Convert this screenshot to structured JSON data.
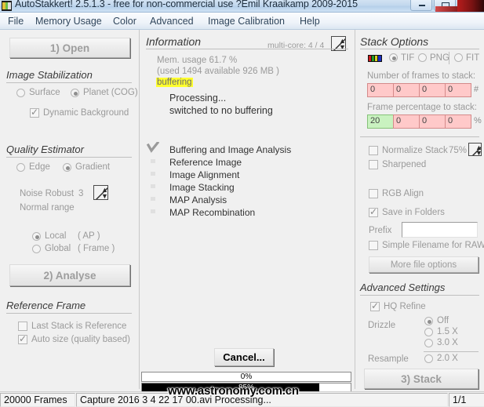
{
  "window": {
    "title": "AutoStakkert! 2.5.1.3 - free for non-commercial use ?Emil Kraaikamp 2009-2015",
    "icon": "app-icon",
    "minimize_label": "",
    "maximize_label": ""
  },
  "menubar": {
    "items": [
      {
        "label": "File"
      },
      {
        "label": "Memory Usage"
      },
      {
        "label": "Color"
      },
      {
        "label": "Advanced"
      },
      {
        "label": "Image Calibration"
      },
      {
        "label": "Help"
      }
    ]
  },
  "left_panel": {
    "open_button": "1) Open",
    "image_stabilization": {
      "title": "Image Stabilization",
      "surface_label": "Surface",
      "surface_selected": false,
      "planet_label": "Planet (COG)",
      "planet_selected": true,
      "dynamic_background_label": "Dynamic Background",
      "dynamic_background_checked": true
    },
    "quality_estimator": {
      "title": "Quality Estimator",
      "edge_label": "Edge",
      "edge_selected": false,
      "gradient_label": "Gradient",
      "gradient_selected": true,
      "noise_robust_label": "Noise Robust",
      "noise_robust_value": "3",
      "normal_range_label": "Normal range",
      "local_label": "Local",
      "local_sub": "( AP )",
      "local_selected": true,
      "global_label": "Global",
      "global_sub": "( Frame )",
      "global_selected": false
    },
    "analyse_button": "2) Analyse",
    "reference_frame": {
      "title": "Reference Frame",
      "last_stack_label": "Last Stack is Reference",
      "last_stack_checked": false,
      "auto_size_label": "Auto size (quality based)",
      "auto_size_checked": true
    }
  },
  "information": {
    "title": "Information",
    "multicore_label": "multi-core: 4 / 4",
    "mem_usage": "Mem. usage 61.7 %",
    "mem_detail": "(used 1494 available 926 MB )",
    "buffering_tag": "buffering",
    "processing_line": "Processing...",
    "switched_line": "switched to no buffering",
    "steps": [
      {
        "label": "Buffering and Image Analysis",
        "done": true
      },
      {
        "label": "Reference Image",
        "done": false
      },
      {
        "label": "Image Alignment",
        "done": false
      },
      {
        "label": "Image Stacking",
        "done": false
      },
      {
        "label": "MAP Analysis",
        "done": false
      },
      {
        "label": "MAP Recombination",
        "done": false
      }
    ],
    "cancel_button": "Cancel...",
    "progress_top": {
      "label": "0%",
      "value": 0
    },
    "progress_bottom": {
      "label": "85%",
      "value": 85
    }
  },
  "stack_options": {
    "title": "Stack Options",
    "formats": [
      {
        "label": "TIF",
        "selected": true
      },
      {
        "label": "PNG",
        "selected": false
      },
      {
        "label": "FIT",
        "selected": false
      }
    ],
    "frames_label": "Number of frames to stack:",
    "frames_values": [
      "0",
      "0",
      "0",
      "0"
    ],
    "frames_unit": "#",
    "percentage_label": "Frame percentage to stack:",
    "percentage_values": [
      "20",
      "0",
      "0",
      "0"
    ],
    "percentage_unit": "%",
    "normalize_label": "Normalize Stack",
    "normalize_checked": false,
    "normalize_value": "75%",
    "sharpened_label": "Sharpened",
    "sharpened_checked": false,
    "rgb_align_label": "RGB Align",
    "rgb_align_checked": false,
    "save_in_folders_label": "Save in Folders",
    "save_in_folders_checked": true,
    "prefix_label": "Prefix",
    "prefix_value": "",
    "simple_filename_label": "Simple Filename for RAW",
    "simple_filename_checked": false,
    "more_file_options_button": "More file options"
  },
  "advanced_settings": {
    "title": "Advanced Settings",
    "hq_refine_label": "HQ Refine",
    "hq_refine_checked": true,
    "drizzle_label": "Drizzle",
    "drizzle_options": [
      {
        "label": "Off",
        "selected": true
      },
      {
        "label": "1.5 X",
        "selected": false
      },
      {
        "label": "3.0 X",
        "selected": false
      }
    ],
    "resample_label": "Resample",
    "resample_option": {
      "label": "2.0 X",
      "selected": false
    },
    "stack_button": "3) Stack"
  },
  "statusbar": {
    "frames": "20000 Frames",
    "capture": "Capture 2016 3 4 22 17 00.avi   Processing...",
    "page": "1/1"
  },
  "watermark": "www.astronomy.com.cn",
  "colors": {
    "accent_blue": "#b6d0ea",
    "highlight_yellow": "#ffff2e",
    "field_pink": "#ffc9c9",
    "field_green": "#c9f2c0",
    "disabled_text": "#9a9a9a"
  }
}
